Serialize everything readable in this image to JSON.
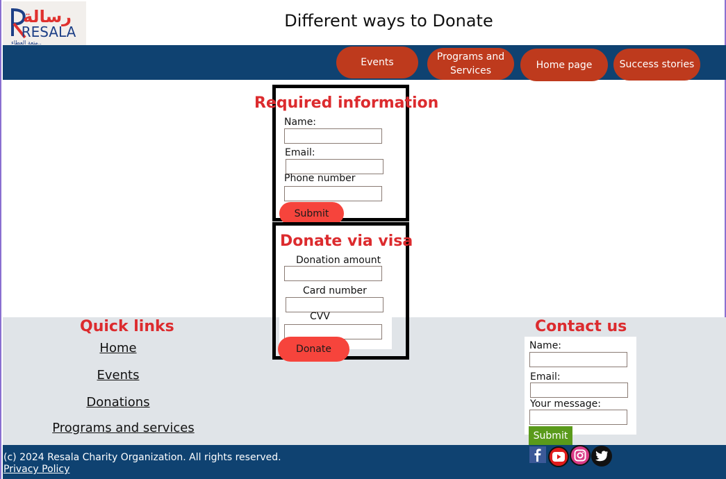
{
  "brand": {
    "logo_text": "RESALA",
    "logo_arabic": "رسالة",
    "logo_tagline": "متعة العطاء..",
    "colors": {
      "navy": "#0f4271",
      "nav_button": "#be3a1d",
      "heading_red": "#dc2b2e",
      "pill_red": "#f6443c",
      "submit_green": "#5a9a1b"
    }
  },
  "header": {
    "title": "Different ways to Donate"
  },
  "nav": {
    "events": "Events",
    "programs_line1": "Programs and",
    "programs_line2": "Services",
    "home": "Home page",
    "success": "Success stories"
  },
  "required_form": {
    "heading": "Required information",
    "name_label": "Name:",
    "name_value": "",
    "email_label": "Email:",
    "email_value": "",
    "phone_label": "Phone number",
    "phone_value": "",
    "submit_label": "Submit"
  },
  "visa_form": {
    "heading": "Donate via visa",
    "amount_label": "Donation amount",
    "amount_value": "",
    "card_label": "Card number",
    "card_value": "",
    "cvv_label": "CVV",
    "cvv_value": "",
    "donate_label": "Donate"
  },
  "quick_links": {
    "heading": "Quick links",
    "items": [
      "Home",
      "Events",
      "Donations",
      "Programs and services"
    ]
  },
  "contact": {
    "heading": "Contact us",
    "name_label": "Name:",
    "email_label": "Email:",
    "message_label": "Your message:",
    "submit_label": "Submit"
  },
  "footer": {
    "copyright": "(c) 2024 Resala Charity Organization. All rights reserved.",
    "privacy": "Privacy Policy",
    "social_icons": [
      "facebook-icon",
      "youtube-icon",
      "instagram-icon",
      "twitter-icon"
    ]
  }
}
